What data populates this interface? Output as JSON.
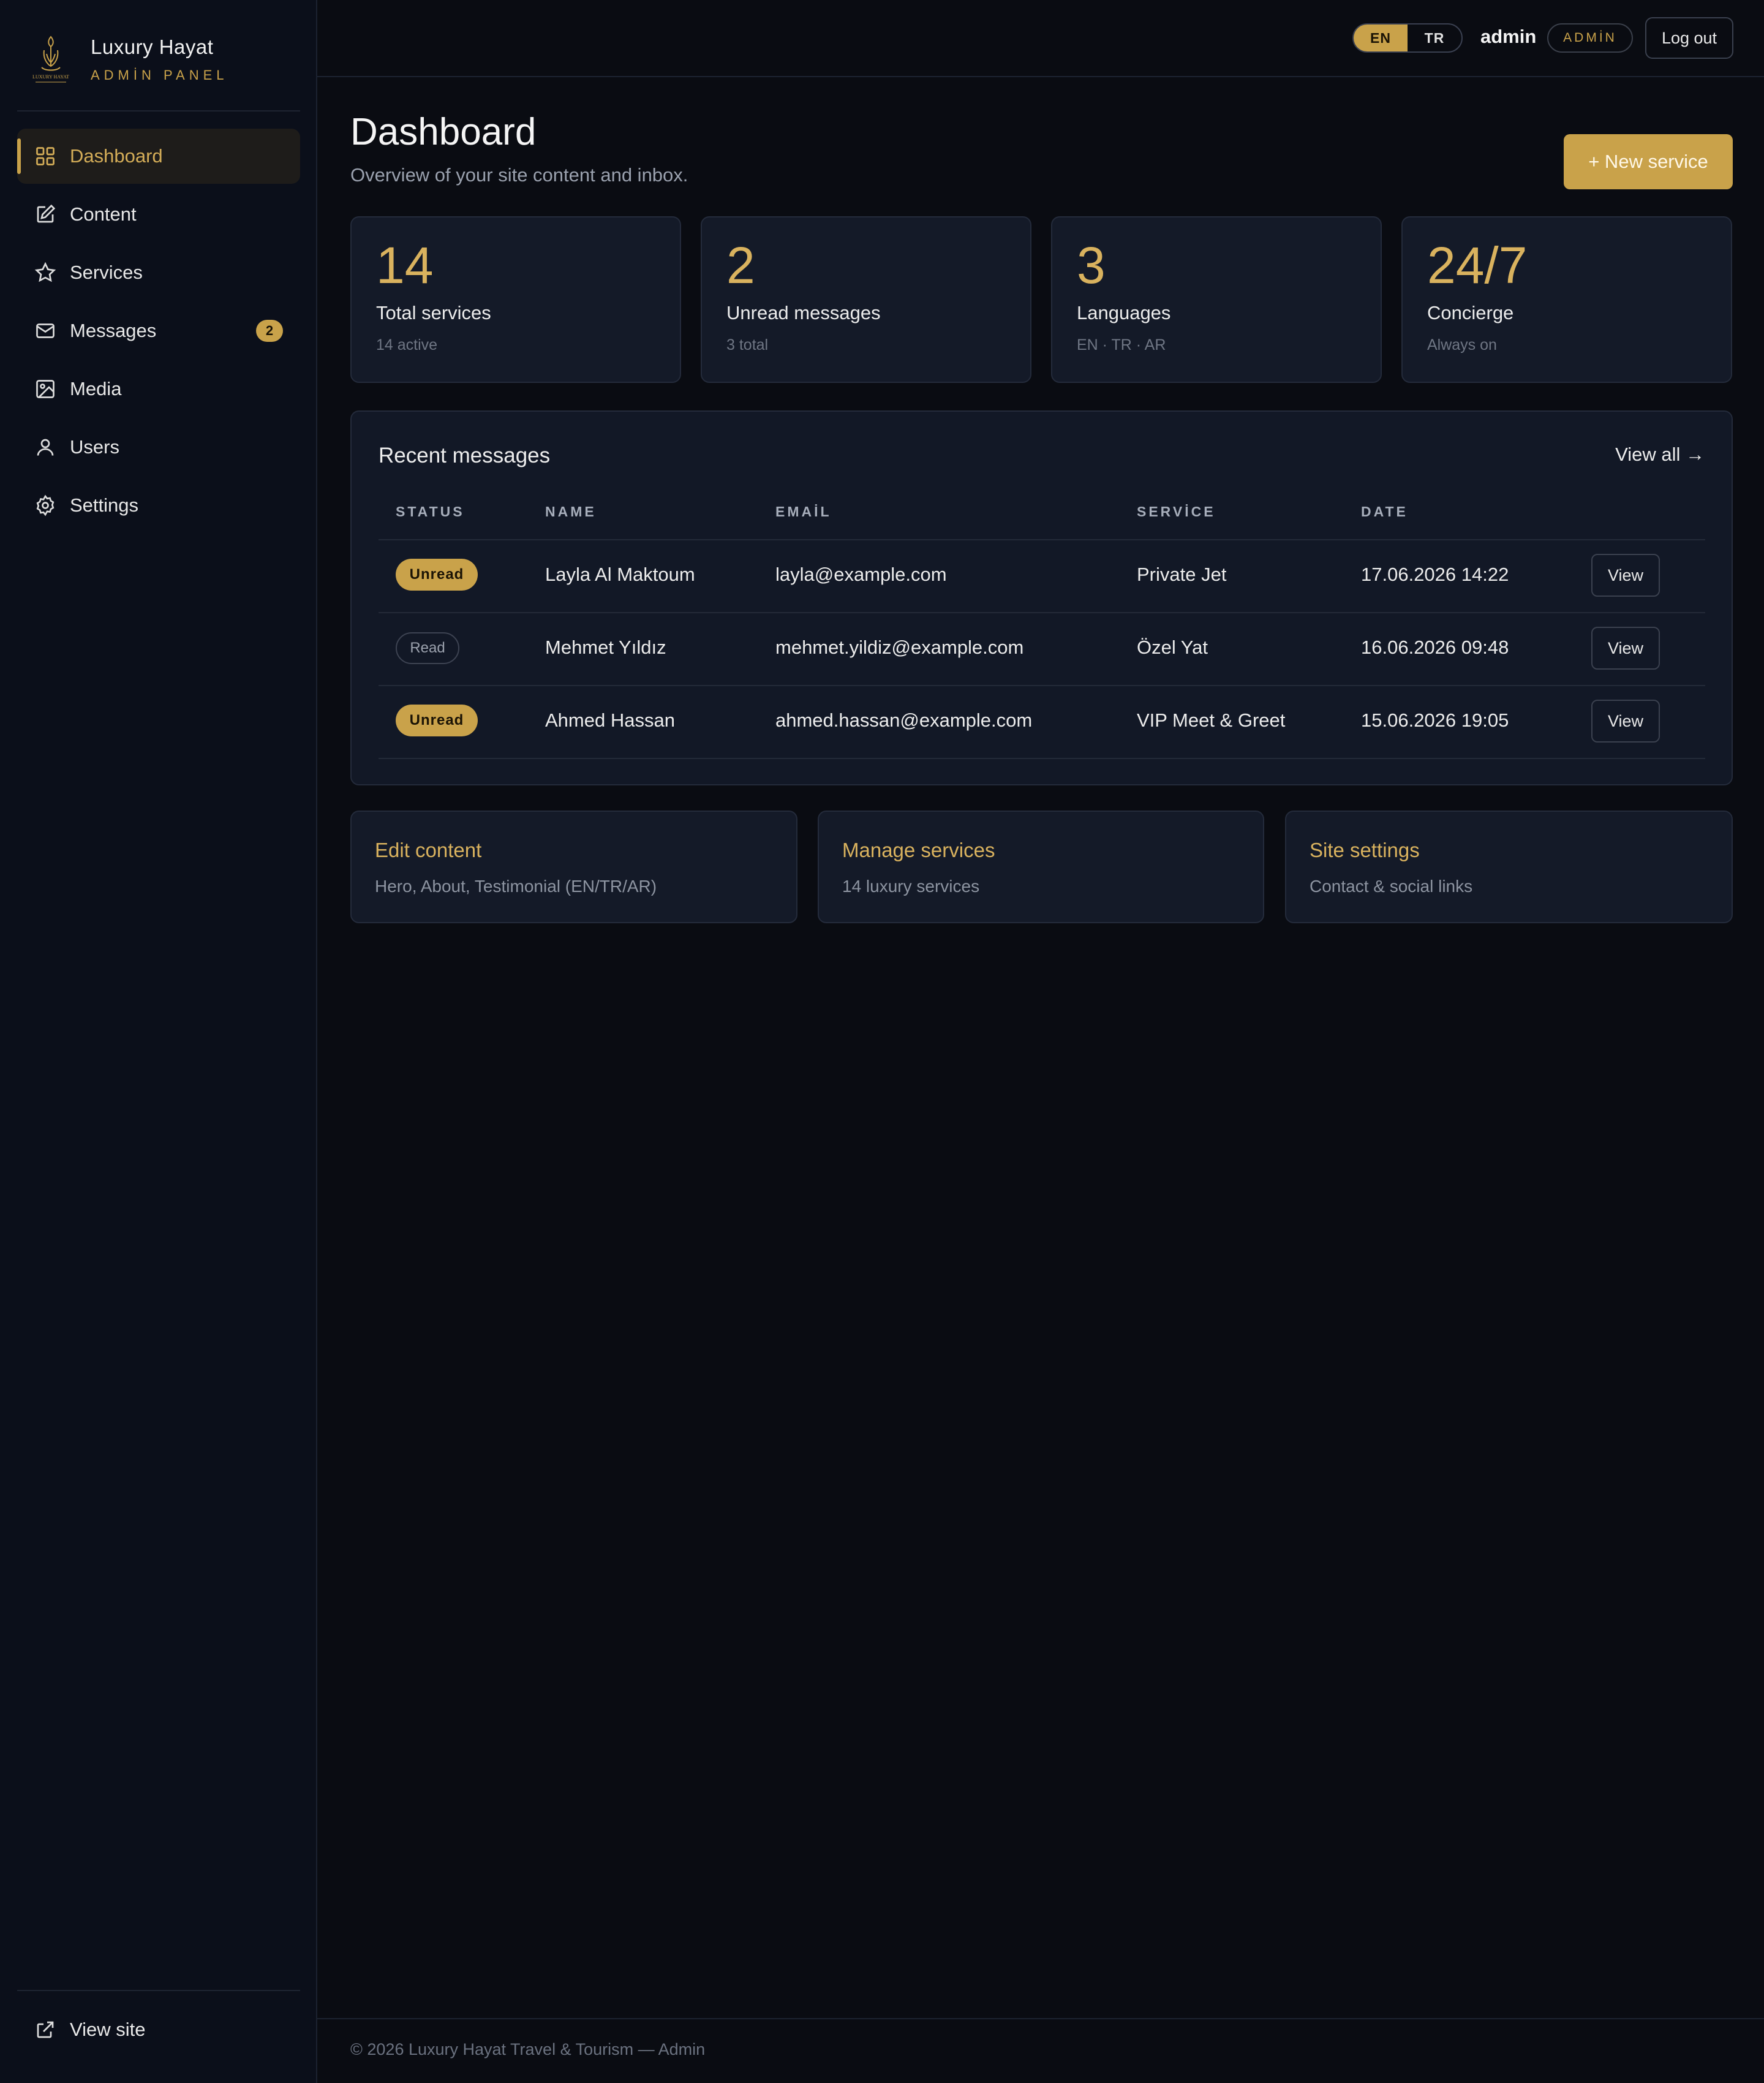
{
  "brand": {
    "name": "Luxury Hayat",
    "subtitle": "ADMİN PANEL",
    "logo_text": "LUXURY HAYAT"
  },
  "sidebar": {
    "items": [
      {
        "label": "Dashboard",
        "icon": "grid-icon",
        "active": true
      },
      {
        "label": "Content",
        "icon": "edit-icon"
      },
      {
        "label": "Services",
        "icon": "star-icon"
      },
      {
        "label": "Messages",
        "icon": "mail-icon",
        "badge": "2"
      },
      {
        "label": "Media",
        "icon": "image-icon"
      },
      {
        "label": "Users",
        "icon": "user-icon"
      },
      {
        "label": "Settings",
        "icon": "gear-icon"
      }
    ],
    "view_site": {
      "label": "View site",
      "icon": "external-link-icon"
    }
  },
  "header": {
    "languages": [
      "EN",
      "TR"
    ],
    "active_language": "EN",
    "user": "admin",
    "role": "ADMİN",
    "logout_label": "Log out"
  },
  "page": {
    "title": "Dashboard",
    "subtitle": "Overview of your site content and inbox.",
    "new_service_label": "+ New service"
  },
  "stats": [
    {
      "value": "14",
      "label": "Total services",
      "sub": "14 active"
    },
    {
      "value": "2",
      "label": "Unread messages",
      "sub": "3 total"
    },
    {
      "value": "3",
      "label": "Languages",
      "sub": "EN · TR · AR"
    },
    {
      "value": "24/7",
      "label": "Concierge",
      "sub": "Always on"
    }
  ],
  "messages": {
    "title": "Recent messages",
    "view_all": "View all →",
    "columns": [
      "STATUS",
      "NAME",
      "EMAİL",
      "SERVİCE",
      "DATE"
    ],
    "rows": [
      {
        "status": "Unread",
        "name": "Layla Al Maktoum",
        "email": "layla@example.com",
        "service": "Private Jet",
        "date": "17.06.2026 14:22",
        "action": "View"
      },
      {
        "status": "Read",
        "name": "Mehmet Yıldız",
        "email": "mehmet.yildiz@example.com",
        "service": "Özel Yat",
        "date": "16.06.2026 09:48",
        "action": "View"
      },
      {
        "status": "Unread",
        "name": "Ahmed Hassan",
        "email": "ahmed.hassan@example.com",
        "service": "VIP Meet & Greet",
        "date": "15.06.2026 19:05",
        "action": "View"
      }
    ]
  },
  "actions": [
    {
      "title": "Edit content",
      "sub": "Hero, About, Testimonial (EN/TR/AR)"
    },
    {
      "title": "Manage services",
      "sub": "14 luxury services"
    },
    {
      "title": "Site settings",
      "sub": "Contact & social links"
    }
  ],
  "footer": {
    "text": "© 2026 Luxury Hayat Travel & Tourism — Admin"
  },
  "colors": {
    "accent": "#c9a24a",
    "background": "#0a0c12",
    "card": "#141a28",
    "sidebar": "#0b0f1a"
  }
}
